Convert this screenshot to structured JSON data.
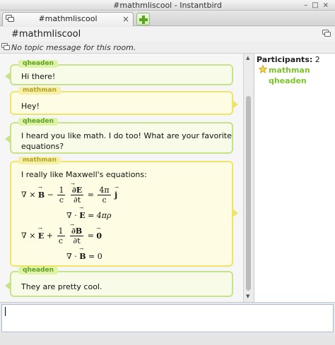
{
  "window": {
    "title": "#mathmliscool - Instantbird"
  },
  "tabs": [
    {
      "label": "#mathmliscool",
      "close": "×"
    }
  ],
  "room": {
    "name": "#mathmliscool",
    "topic": "No topic message for this room."
  },
  "messages": [
    {
      "nick": "qheaden",
      "text": "Hi there!"
    },
    {
      "nick": "mathman",
      "text": "Hey!"
    },
    {
      "nick": "qheaden",
      "text_line1": "I heard you like math. I do too! What are your favorite",
      "text_line2": "equations?"
    },
    {
      "nick": "mathman",
      "text": "I really like Maxwell's equations:"
    },
    {
      "nick": "qheaden",
      "text": "They are pretty cool."
    }
  ],
  "math": {
    "nabla": "∇",
    "cross": "×",
    "dot": "·",
    "minus": "−",
    "plus": "+",
    "equals": "=",
    "B": "B",
    "E": "E",
    "j": "j",
    "one": "1",
    "c": "c",
    "dE": "∂E",
    "dB": "∂B",
    "dt": "∂t",
    "four_pi": "4π",
    "four_pi_rho": "4πρ",
    "zero": "0"
  },
  "participants": {
    "label": "Participants:",
    "count": "2",
    "list": [
      {
        "name": "mathman",
        "icon": "star-icon"
      },
      {
        "name": "qheaden"
      }
    ]
  },
  "colors": {
    "incoming_border": "#c6e38c",
    "outgoing_border": "#efe46a",
    "participant_name": "#7dc42a"
  }
}
